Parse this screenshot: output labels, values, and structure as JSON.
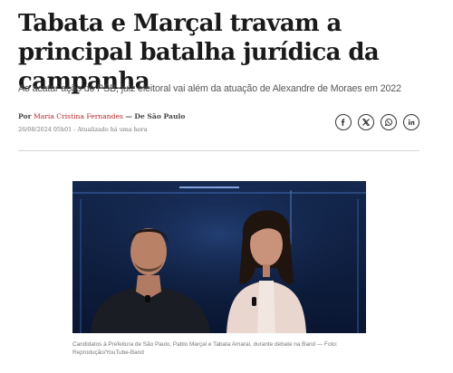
{
  "article": {
    "headline": "Tabata e Marçal travam a principal batalha jurídica da campanha",
    "subtitle": "Ao acatar ação do PSB, juiz eleitoral vai além da atuação de Alexandre de Moraes em 2022",
    "byline": {
      "prefix": "Por",
      "author": "Maria Cristina Fernandes",
      "separator": "—",
      "location": "De São Paulo"
    },
    "published": "26/08/2024 05h01",
    "updated": "Atualizado há uma hora",
    "image_caption": "Candidatos à Prefeitura de São Paulo, Pablo Marçal e Tabata Amaral, durante debate na Band — Foto: Reprodução/YouTube-Band"
  },
  "share": {
    "icons": [
      "facebook-icon",
      "x-icon",
      "whatsapp-icon",
      "linkedin-icon"
    ]
  }
}
